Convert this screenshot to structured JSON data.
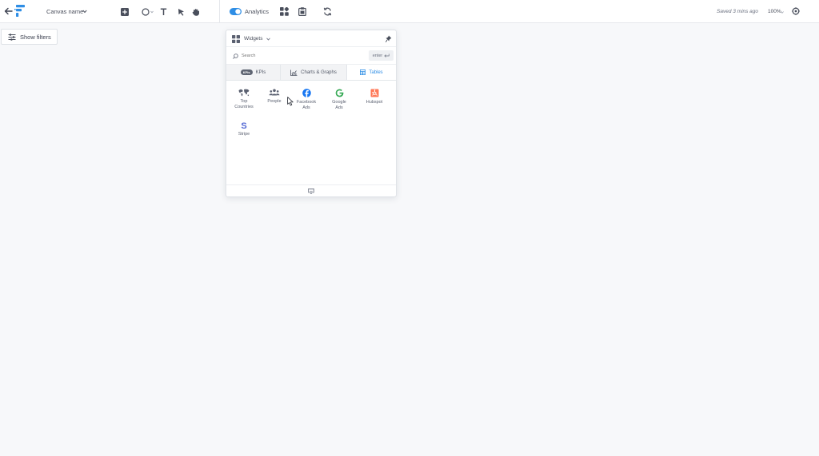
{
  "topbar": {
    "canvas_name": "Canvas name",
    "analytics_label": "Analytics",
    "analytics_on": true,
    "saved_status": "Saved 3 mins ago",
    "zoom": "100%"
  },
  "filters": {
    "show_label": "Show filters"
  },
  "widgets_panel": {
    "title": "Widgets",
    "search_placeholder": "Search",
    "enter_label": "enter",
    "tabs": [
      {
        "label": "KPIs",
        "badge": "KPIs",
        "active": false
      },
      {
        "label": "Charts & Graphs",
        "active": false
      },
      {
        "label": "Tables",
        "active": true
      }
    ],
    "items": [
      {
        "label": "Top\nCountries",
        "icon": "world-map-icon"
      },
      {
        "label": "People",
        "icon": "people-icon"
      },
      {
        "label": "Facebook\nAds",
        "icon": "facebook-icon"
      },
      {
        "label": "Google\nAds",
        "icon": "google-icon"
      },
      {
        "label": "Hubspot",
        "icon": "hubspot-icon"
      },
      {
        "label": "Stripe",
        "icon": "stripe-icon"
      }
    ]
  },
  "colors": {
    "accent": "#2f8ee5",
    "facebook": "#1877f2",
    "google_green": "#34a853",
    "hubspot": "#ff7a59",
    "stripe": "#5469d4"
  }
}
